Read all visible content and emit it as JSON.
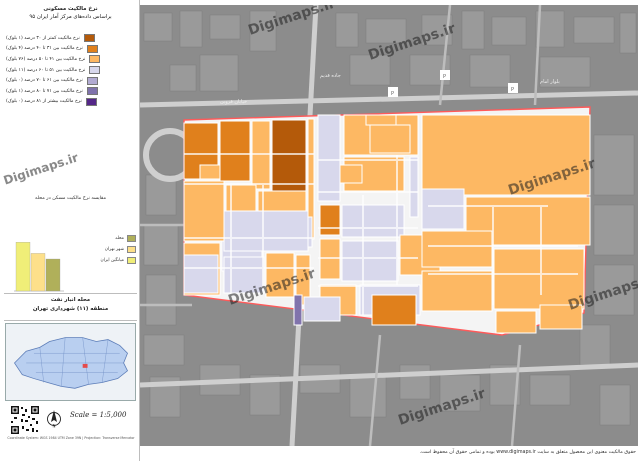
{
  "title": {
    "line1": "نرخ مالکیت مسکونی",
    "line2": "براساس داده‌های مرکز آمار ایران ۹۵"
  },
  "legend": {
    "items": [
      {
        "label": "نرخ مالکیت کمتر از ۳۰ درصد (۱ بلوک)",
        "color": "#b45a0a"
      },
      {
        "label": "نرخ مالکیت بین ۳۱ تا ۴۰ درصد (۴ بلوک)",
        "color": "#e0801c"
      },
      {
        "label": "نرخ مالکیت بین ۴۱ تا ۵۰ درصد (۷۶ بلوک)",
        "color": "#fdb863"
      },
      {
        "label": "نرخ مالکیت بین ۵۱ تا ۶۰ درصد (۱۱ بلوک)",
        "color": "#d8d8ec"
      },
      {
        "label": "نرخ مالکیت بین ۶۱ تا ۷۰ درصد (۰ بلوک)",
        "color": "#b2abd2"
      },
      {
        "label": "نرخ مالکیت بین ۷۱ تا ۸۰ درصد (۱ بلوک)",
        "color": "#8073ac"
      },
      {
        "label": "نرخ مالکیت بیشتر از ۸۱ درصد (۰ بلوک)",
        "color": "#542788"
      }
    ]
  },
  "chart": {
    "title": "مقایسه نرخ مالکیت مسکن در محله",
    "items": [
      {
        "label": "میانگین ایران",
        "color": "#f0ee78"
      },
      {
        "label": "شهر تهران",
        "color": "#fde08a"
      },
      {
        "label": "محله",
        "color": "#b0b05a"
      }
    ]
  },
  "location": {
    "line1": "محله انبار نفت",
    "line2": "منطقه (۱۱) شهرداری تهران"
  },
  "scale": "Scale = 1:5,000",
  "credit": "Coordinate System: WGS 1984 UTM Zone 39N | Projection: Transverse Mercator",
  "footer": "حقوق مالکیت معنوی این محصول متعلق به سایت www.digimaps.ir بوده و تمامی حقوق آن محفوظ است.",
  "watermark": "Digimaps.ir",
  "map": {
    "street_labels": [
      "خیابان قزوین",
      "جاده قدیم",
      "بلوار امام"
    ]
  },
  "colors": {
    "street": "#f4f4f4",
    "background": "#8c8c8c",
    "boundary": "#ff5a5a",
    "road": "#d0d0d0"
  },
  "chart_data": {
    "type": "bar",
    "categories": [
      "میانگین ایران",
      "شهر تهران",
      "محله"
    ],
    "values": [
      61,
      47,
      40
    ],
    "ylim": [
      0,
      100
    ]
  }
}
